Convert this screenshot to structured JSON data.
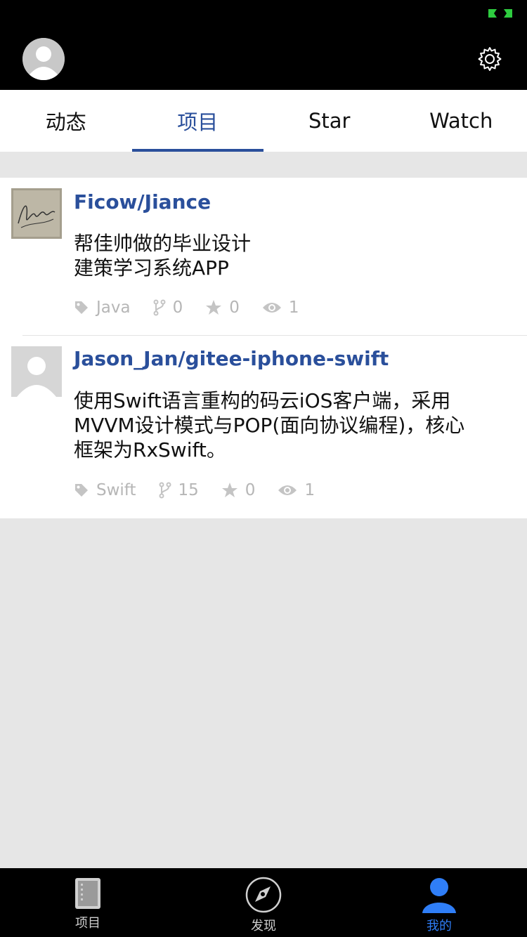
{
  "tabs": [
    {
      "label": "动态",
      "active": false
    },
    {
      "label": "项目",
      "active": true
    },
    {
      "label": "Star",
      "active": false
    },
    {
      "label": "Watch",
      "active": false
    }
  ],
  "repos": [
    {
      "name": "Ficow/Jiance",
      "desc_lines": [
        "帮佳帅做的毕业设计",
        "建策学习系统APP"
      ],
      "language": "Java",
      "forks": "0",
      "stars": "0",
      "watchers": "1"
    },
    {
      "name": "Jason_Jan/gitee-iphone-swift",
      "desc_lines": [
        "使用Swift语言重构的码云iOS客户端，采用",
        "MVVM设计模式与POP(面向协议编程)，核心",
        "框架为RxSwift。"
      ],
      "language": "Swift",
      "forks": "15",
      "stars": "0",
      "watchers": "1"
    }
  ],
  "tabbar": [
    {
      "label": "项目",
      "icon": "repo-book-icon",
      "active": false
    },
    {
      "label": "发现",
      "icon": "compass-icon",
      "active": false
    },
    {
      "label": "我的",
      "icon": "person-icon",
      "active": true
    }
  ],
  "colors": {
    "accent": "#2a4f9b",
    "tabbar_active": "#2f7ef7",
    "status_green": "#2ecc40"
  }
}
